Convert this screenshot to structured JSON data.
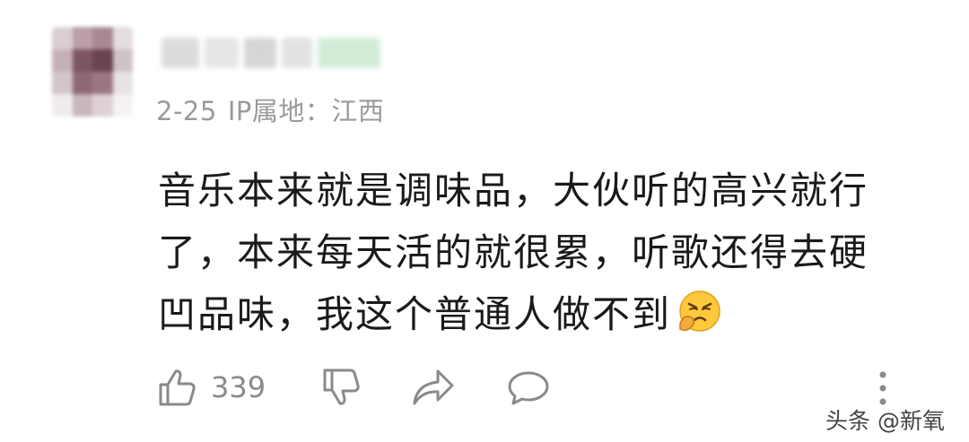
{
  "comment": {
    "date": "2-25",
    "ip_location": "IP属地：江西",
    "text": "音乐本来就是调味品，大伙听的高兴就行了，本来每天活的就很累，听歌还得去硬凹品味，我这个普通人做不到",
    "emoji": "face-with-hand-icon",
    "like_count": "339"
  },
  "watermark": "头条 @新氧",
  "colors": {
    "meta_text": "#9a9a9a",
    "body_text": "#1a1a1a",
    "icon_stroke": "#8a8a8a"
  }
}
